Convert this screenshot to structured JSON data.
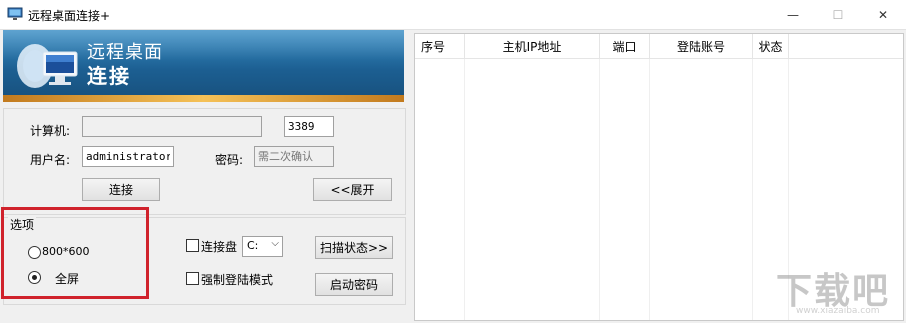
{
  "window": {
    "title": "远程桌面连接+",
    "minimize_glyph": "—",
    "maximize_glyph": "☐",
    "close_glyph": "✕"
  },
  "banner": {
    "line1": "远程桌面",
    "line2": "连接"
  },
  "form": {
    "computer_label": "计算机:",
    "computer_value": "",
    "port_value": "3389",
    "username_label": "用户名:",
    "username_value": "administrator",
    "password_label": "密码:",
    "password_placeholder": "需二次确认",
    "connect_button": "连接",
    "expand_button": "<<展开"
  },
  "options": {
    "legend": "选项",
    "radio_800": "800*600",
    "radio_fullscreen": "全屏",
    "radio_selected": "全屏",
    "connect_disk_label": "连接盘",
    "connect_disk_checked": false,
    "drive_value": "C:",
    "force_login_label": "强制登陆模式",
    "force_login_checked": false,
    "scan_button": "扫描状态>>",
    "start_password_button": "启动密码"
  },
  "list": {
    "columns": [
      "序号",
      "主机IP地址",
      "端口",
      "登陆账号",
      "状态"
    ],
    "rows": []
  },
  "watermark": {
    "main": "下载吧",
    "sub": "www.xiazaiba.com"
  },
  "colors": {
    "highlight": "#d0222c",
    "banner_blue": "#1c5f92",
    "banner_gold": "#f5c157"
  }
}
